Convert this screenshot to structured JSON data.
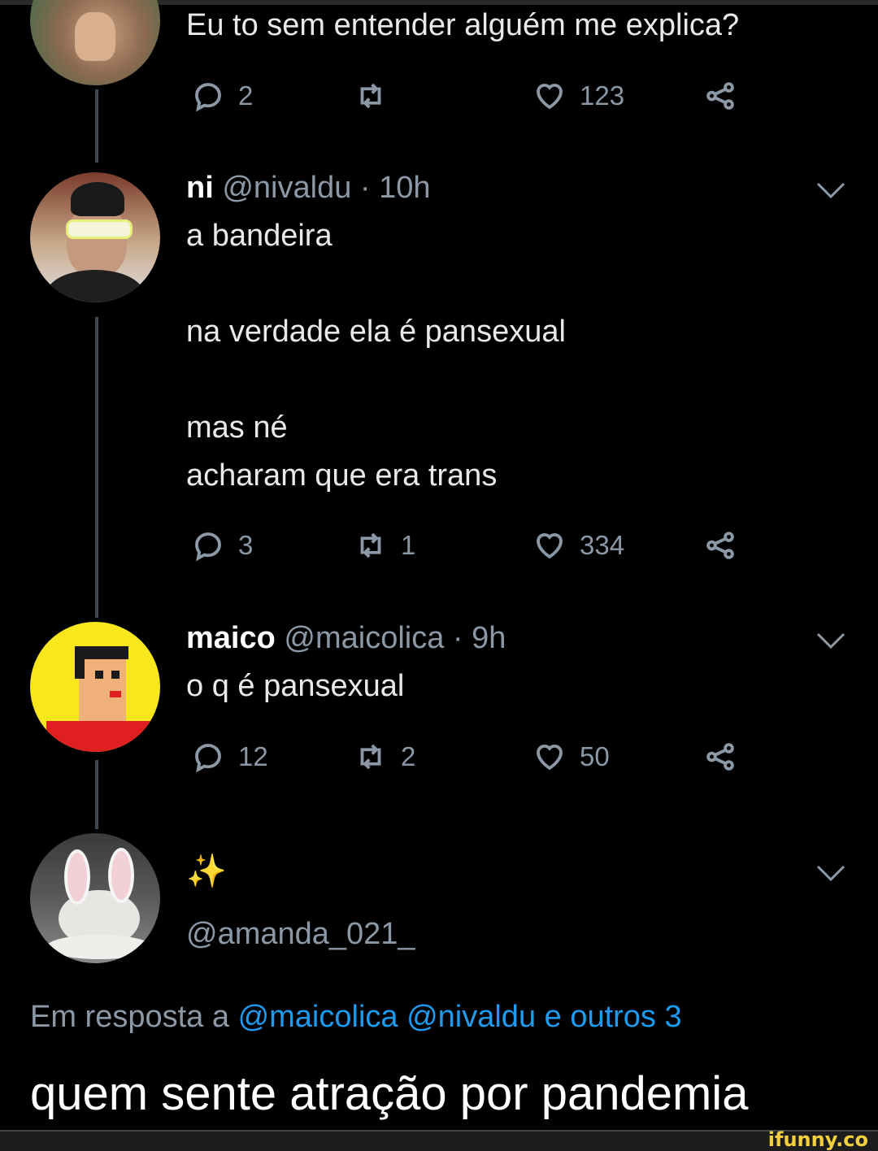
{
  "tweet1": {
    "text": "Eu to sem entender alguém me explica?",
    "replies": "2",
    "retweets": "",
    "likes": "123"
  },
  "tweet2": {
    "name": "ni",
    "handle": "@nivaldu",
    "sep": " · ",
    "time": "10h",
    "lines": [
      "a bandeira",
      "na verdade ela é pansexual",
      "mas né",
      "acharam que era trans"
    ],
    "replies": "3",
    "retweets": "1",
    "likes": "334"
  },
  "tweet3": {
    "name": "maico",
    "handle": "@maicolica",
    "sep": " · ",
    "time": "9h",
    "text": "o q é pansexual",
    "replies": "12",
    "retweets": "2",
    "likes": "50"
  },
  "tweet4": {
    "name_emoji": "✨",
    "handle": "@amanda_021_",
    "reply_prefix": "Em resposta a ",
    "reply_link": "@maicolica @nivaldu e outros 3",
    "text": "quem sente atração por pandemia"
  },
  "watermark": "ifunny.co",
  "colors": {
    "background": "#000000",
    "link": "#1d9bf0",
    "muted": "#8b98a5",
    "thread": "#3d4a56"
  }
}
